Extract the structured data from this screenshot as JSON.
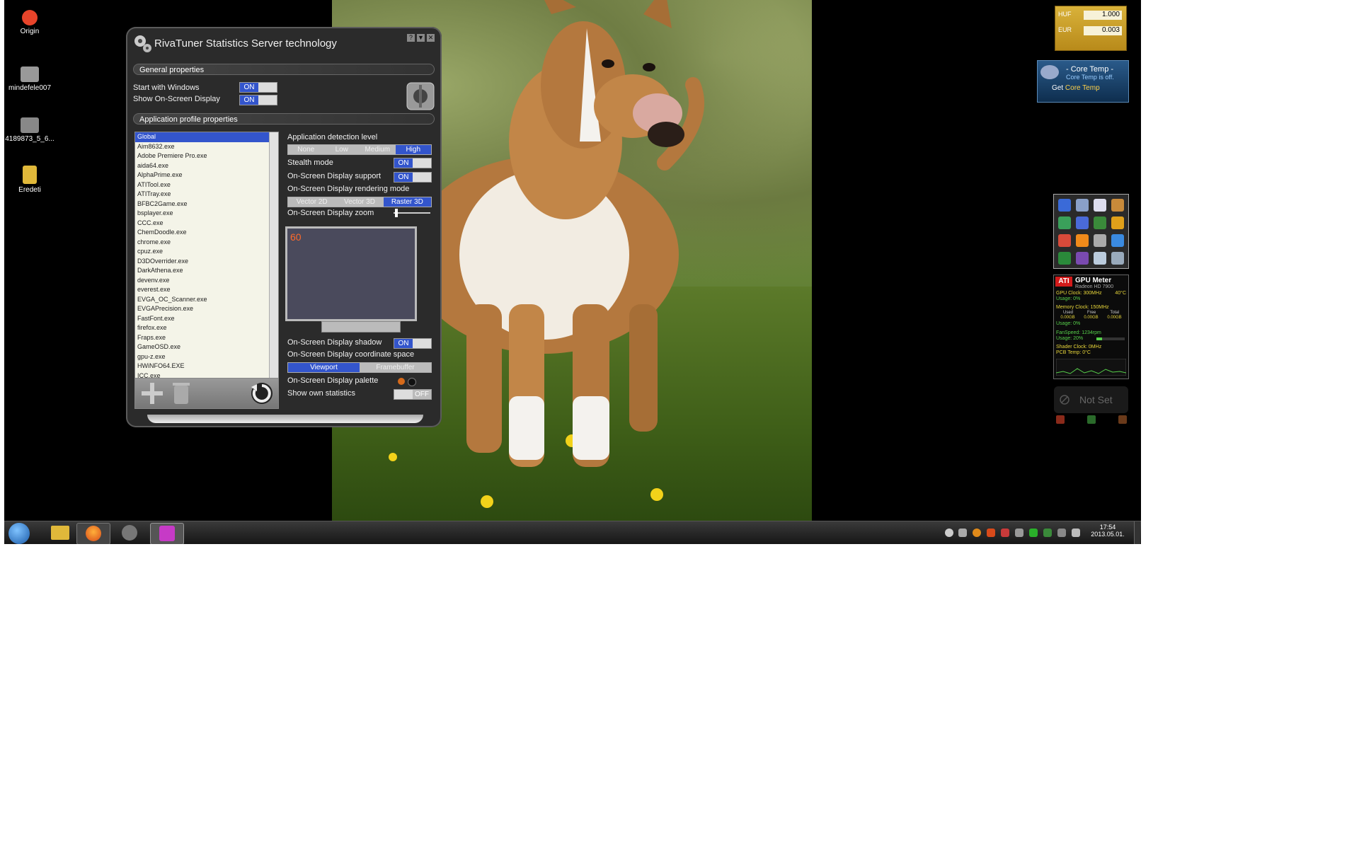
{
  "desktop": {
    "icons": [
      {
        "label": "Origin",
        "icon": "origin-icon",
        "color": "#e8442a"
      },
      {
        "label": "mindefele007",
        "icon": "image-file-icon",
        "color": "#999999"
      },
      {
        "label": "4189873_5_6...",
        "icon": "image-file-icon",
        "color": "#888888"
      },
      {
        "label": "Eredeti",
        "icon": "folder-icon",
        "color": "#e0b83a"
      }
    ]
  },
  "rtss": {
    "title": "RivaTuner Statistics Server technology",
    "controls": [
      "?",
      "▼",
      "✕"
    ],
    "general_header": "General properties",
    "start_with_windows": "Start with Windows",
    "show_osd": "Show On-Screen Display",
    "on": "ON",
    "off": "OFF",
    "profile_header": "Application profile properties",
    "apps": [
      "Global",
      "Aim8632.exe",
      "Adobe Premiere Pro.exe",
      "aida64.exe",
      "AlphaPrime.exe",
      "ATITool.exe",
      "ATITray.exe",
      "BFBC2Game.exe",
      "bsplayer.exe",
      "CCC.exe",
      "ChemDoodle.exe",
      "chrome.exe",
      "cpuz.exe",
      "D3DOverrider.exe",
      "DarkAthena.exe",
      "devenv.exe",
      "everest.exe",
      "EVGA_OC_Scanner.exe",
      "EVGAPrecision.exe",
      "FastFont.exe",
      "firefox.exe",
      "Fraps.exe",
      "GameOSD.exe",
      "gpu-z.exe",
      "HWiNFO64.EXE",
      "ICC.exe"
    ],
    "detection_level": "Application detection level",
    "detection_options": [
      "None",
      "Low",
      "Medium",
      "High"
    ],
    "detection_selected": 3,
    "stealth_mode": "Stealth mode",
    "osd_support": "On-Screen Display support",
    "rendering_mode": "On-Screen Display rendering mode",
    "rendering_options": [
      "Vector 2D",
      "Vector 3D",
      "Raster 3D"
    ],
    "rendering_selected": 2,
    "osd_zoom": "On-Screen Display zoom",
    "zoom_level": 0.05,
    "preview_value": "60",
    "osd_shadow": "On-Screen Display shadow",
    "coord_space": "On-Screen Display coordinate space",
    "coord_options": [
      "Viewport",
      "Framebuffer"
    ],
    "coord_selected": 0,
    "palette": "On-Screen Display palette",
    "own_stats": "Show own statistics"
  },
  "widgets": {
    "currency": [
      {
        "label": "HUF",
        "value": "1.000"
      },
      {
        "label": "EUR",
        "value": "0.003"
      }
    ],
    "coretemp": {
      "title": "- Core Temp -",
      "subtitle": "Core Temp is off.",
      "link_prefix": "Get",
      "link": "Core Temp"
    },
    "gpu": {
      "title": "GPU Meter",
      "model": "Radeon HD 7900",
      "gpu_clock": "GPU Clock: 300MHz",
      "temp": "40°C",
      "usage": "Usage: 0%",
      "memory_clock": "Memory Clock: 150MHz",
      "mem_headers": [
        "Used",
        "Free",
        "Total"
      ],
      "mem_values": [
        "0.00GB",
        "0.00GB",
        "0.00GB"
      ],
      "mem_usage": "Usage: 0%",
      "fan": "FanSpeed: 1234rpm",
      "fan_usage": "Usage: 20%",
      "shader": "Shader Clock: 0MHz",
      "pcb": "PCB Temp: 0°C"
    },
    "notset": "Not Set"
  },
  "taskbar": {
    "time": "17:54",
    "date": "2013.05.01."
  },
  "colors": {
    "accent": "#3355cc",
    "gpu_text": "#e8d63a",
    "gpu_green": "#57d04b"
  }
}
